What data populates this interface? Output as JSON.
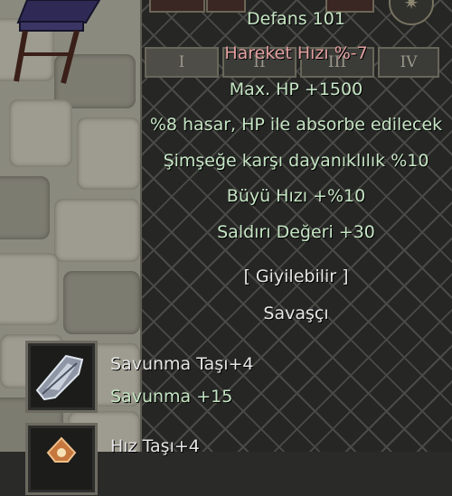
{
  "tooltip": {
    "defense": "Defans 101",
    "move_speed": "Hareket Hızı %-7",
    "max_hp": "Max. HP +1500",
    "absorb": "%8 hasar, HP ile absorbe edilecek",
    "lightning_res": "Şimşeğe karşı dayanıklılık %10",
    "cast_speed": "Büyü Hızı +%10",
    "attack_value": "Saldırı Değeri +30",
    "wearable": "[ Giyilebilir ]",
    "class": "Savaşçı"
  },
  "tabs": [
    "I",
    "II",
    "III",
    "IV"
  ],
  "active_tab": 0,
  "sockets": [
    {
      "icon": "defense-stone-icon",
      "name": "Savunma Taşı+4",
      "bonus": "Savunma +15"
    },
    {
      "icon": "speed-stone-icon",
      "name": "Hız Taşı+4"
    }
  ],
  "colors": {
    "bonus_text": "#c6e6c4",
    "penalty_text": "#e4a0a0",
    "plain_text": "#e6e6e6",
    "panel_bg": "#262625",
    "lattice": "#4a4a46"
  }
}
